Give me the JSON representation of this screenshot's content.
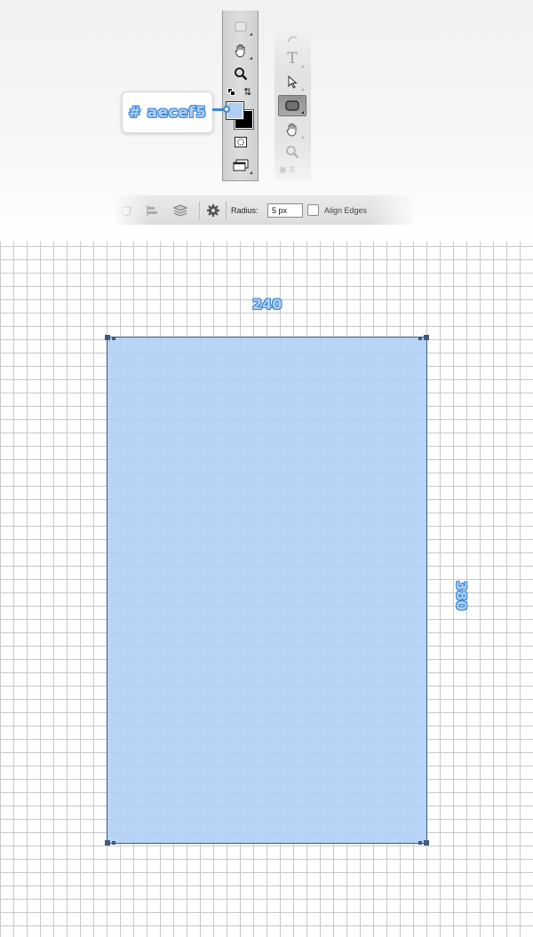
{
  "toolbar": {
    "tools": [
      {
        "name": "rectangle-tool"
      },
      {
        "name": "hand-tool"
      },
      {
        "name": "zoom-tool"
      }
    ],
    "foreground_color": "#aecef5",
    "background_color": "#000000",
    "faded_tools": [
      {
        "name": "pen-tool"
      },
      {
        "name": "type-tool"
      },
      {
        "name": "path-selection-tool"
      },
      {
        "name": "rounded-rectangle-tool",
        "active": true
      },
      {
        "name": "hand-tool"
      },
      {
        "name": "zoom-tool"
      }
    ]
  },
  "callout": {
    "color_code": "# aecef5"
  },
  "options_bar": {
    "radius_label": "Radius:",
    "radius_value": "5 px",
    "align_edges_label": "Align Edges",
    "align_edges_checked": false
  },
  "canvas": {
    "shape_fill": "#aecef5",
    "shape_width_label": "240",
    "shape_height_label": "380"
  },
  "colors": {
    "accent": "#3a86d4",
    "shape_fill": "#aecef5",
    "grid_line": "#c8c8c8",
    "shape_stroke": "#3d5a80"
  }
}
